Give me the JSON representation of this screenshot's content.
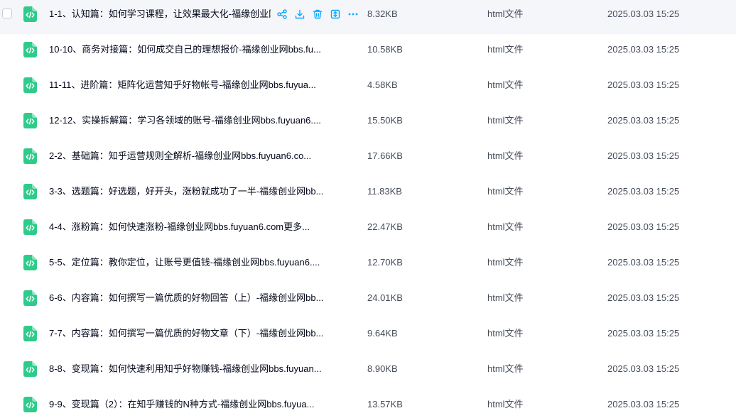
{
  "icons": {
    "file_icon": "html-file-icon",
    "share": "share-icon",
    "download": "download-icon",
    "delete": "trash-icon",
    "move": "move-icon",
    "more": "more-icon"
  },
  "colors": {
    "file_icon": "#2ecb8b",
    "action_icon": "#06a7ff",
    "hover_row": "#f5f6fa"
  },
  "files": [
    {
      "name": "1-1、认知篇：如何学习课程，让效果最大化-福缘创业网bl",
      "size": "8.32KB",
      "type": "html文件",
      "date": "2025.03.03 15:25"
    },
    {
      "name": "10-10、商务对接篇：如何成交自己的理想报价-福缘创业网bbs.fu...",
      "size": "10.58KB",
      "type": "html文件",
      "date": "2025.03.03 15:25"
    },
    {
      "name": "11-11、进阶篇：矩阵化运营知乎好物帐号-福缘创业网bbs.fuyua...",
      "size": "4.58KB",
      "type": "html文件",
      "date": "2025.03.03 15:25"
    },
    {
      "name": "12-12、实操拆解篇：学习各领域的账号-福缘创业网bbs.fuyuan6....",
      "size": "15.50KB",
      "type": "html文件",
      "date": "2025.03.03 15:25"
    },
    {
      "name": "2-2、基础篇：知乎运营规则全解析-福缘创业网bbs.fuyuan6.co...",
      "size": "17.66KB",
      "type": "html文件",
      "date": "2025.03.03 15:25"
    },
    {
      "name": "3-3、选题篇：好选题，好开头，涨粉就成功了一半-福缘创业网bb...",
      "size": "11.83KB",
      "type": "html文件",
      "date": "2025.03.03 15:25"
    },
    {
      "name": "4-4、涨粉篇：如何快速涨粉-福缘创业网bbs.fuyuan6.com更多...",
      "size": "22.47KB",
      "type": "html文件",
      "date": "2025.03.03 15:25"
    },
    {
      "name": "5-5、定位篇：教你定位，让账号更值钱-福缘创业网bbs.fuyuan6....",
      "size": "12.70KB",
      "type": "html文件",
      "date": "2025.03.03 15:25"
    },
    {
      "name": "6-6、内容篇：如何撰写一篇优质的好物回答（上）-福缘创业网bb...",
      "size": "24.01KB",
      "type": "html文件",
      "date": "2025.03.03 15:25"
    },
    {
      "name": "7-7、内容篇：如何撰写一篇优质的好物文章（下）-福缘创业网bb...",
      "size": "9.64KB",
      "type": "html文件",
      "date": "2025.03.03 15:25"
    },
    {
      "name": "8-8、变现篇：如何快速利用知乎好物赚钱-福缘创业网bbs.fuyuan...",
      "size": "8.90KB",
      "type": "html文件",
      "date": "2025.03.03 15:25"
    },
    {
      "name": "9-9、变现篇（2）：在知乎赚钱的N种方式-福缘创业网bbs.fuyua...",
      "size": "13.57KB",
      "type": "html文件",
      "date": "2025.03.03 15:25"
    }
  ]
}
